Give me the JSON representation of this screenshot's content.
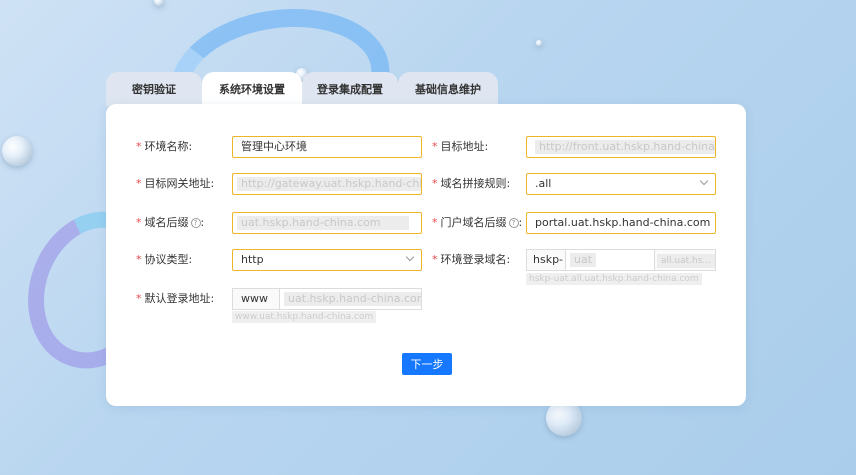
{
  "tabs": [
    {
      "label": "密钥验证"
    },
    {
      "label": "系统环境设置"
    },
    {
      "label": "登录集成配置"
    },
    {
      "label": "基础信息维护"
    }
  ],
  "form": {
    "env_name": {
      "label": "环境名称:",
      "value": "管理中心环境"
    },
    "target_addr": {
      "label": "目标地址:",
      "placeholder": "http://front.uat.hskp.hand-china.com"
    },
    "gateway_addr": {
      "label": "目标网关地址:",
      "placeholder": "http://gateway.uat.hskp.hand-china.com"
    },
    "domain_rule": {
      "label": "域名拼接规则:",
      "value": ".all"
    },
    "domain_suffix": {
      "label": "域名后缀",
      "placeholder": "uat.hskp.hand-china.com"
    },
    "portal_suffix": {
      "label": "门户域名后缀",
      "value": "portal.uat.hskp.hand-china.com"
    },
    "protocol": {
      "label": "协议类型:",
      "value": "http"
    },
    "env_login_domain": {
      "label": "环境登录域名:",
      "prefix": "hskp-",
      "middle_placeholder": "uat",
      "suffix_placeholder": "all.uat.hs...",
      "hint": "hskp-uat.all.uat.hskp.hand-china.com"
    },
    "default_login": {
      "label": "默认登录地址:",
      "prefix": "www",
      "placeholder": "uat.hskp.hand-china.com",
      "hint": "www.uat.hskp.hand-china.com"
    }
  },
  "actions": {
    "next_label": "下一步"
  },
  "colors": {
    "accent": "#1677ff",
    "required": "#e5484d",
    "field_border": "#f0b429"
  }
}
